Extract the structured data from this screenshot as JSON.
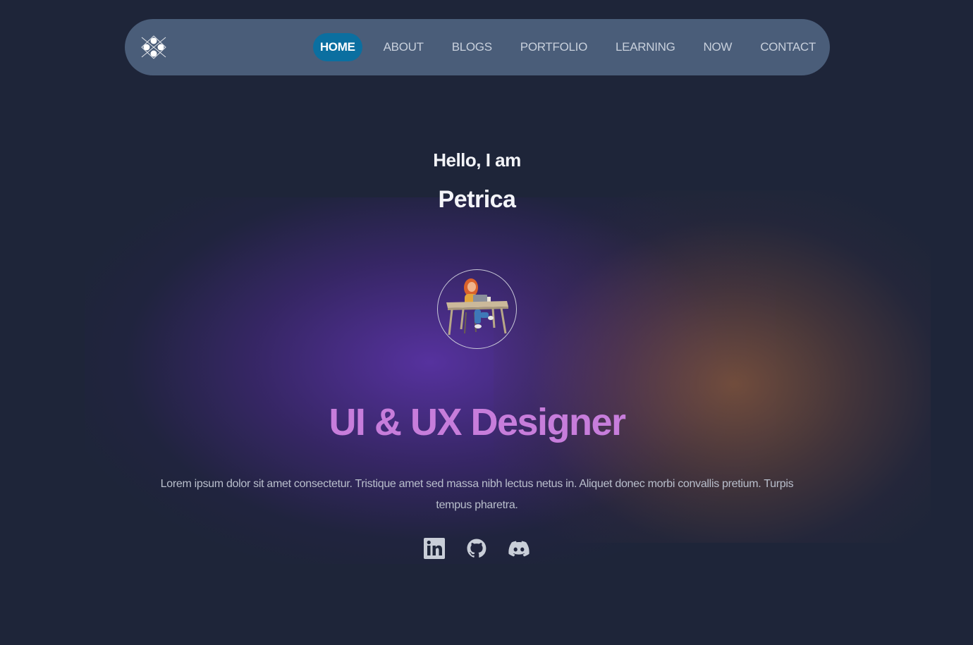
{
  "nav": {
    "logo_icon": "diamond-dots-logo",
    "items": [
      {
        "label": "HOME",
        "active": true
      },
      {
        "label": "ABOUT",
        "active": false
      },
      {
        "label": "BLOGS",
        "active": false
      },
      {
        "label": "PORTFOLIO",
        "active": false
      },
      {
        "label": "LEARNING",
        "active": false
      },
      {
        "label": "NOW",
        "active": false
      },
      {
        "label": "CONTACT",
        "active": false
      }
    ],
    "active_color": "#0b6fa0",
    "background_color": "#4a5d79"
  },
  "hero": {
    "greeting": "Hello, I am",
    "name": "Petrica",
    "avatar_icon": "person-at-desk-illustration",
    "role": "UI & UX Designer",
    "role_color": "#c77ddb",
    "description": "Lorem ipsum dolor sit amet consectetur. Tristique amet sed massa nibh lectus netus in. Aliquet donec morbi convallis pretium. Turpis tempus pharetra."
  },
  "socials": [
    {
      "icon": "linkedin-icon"
    },
    {
      "icon": "github-icon"
    },
    {
      "icon": "discord-icon"
    }
  ],
  "colors": {
    "page_background": "#1e2539"
  }
}
